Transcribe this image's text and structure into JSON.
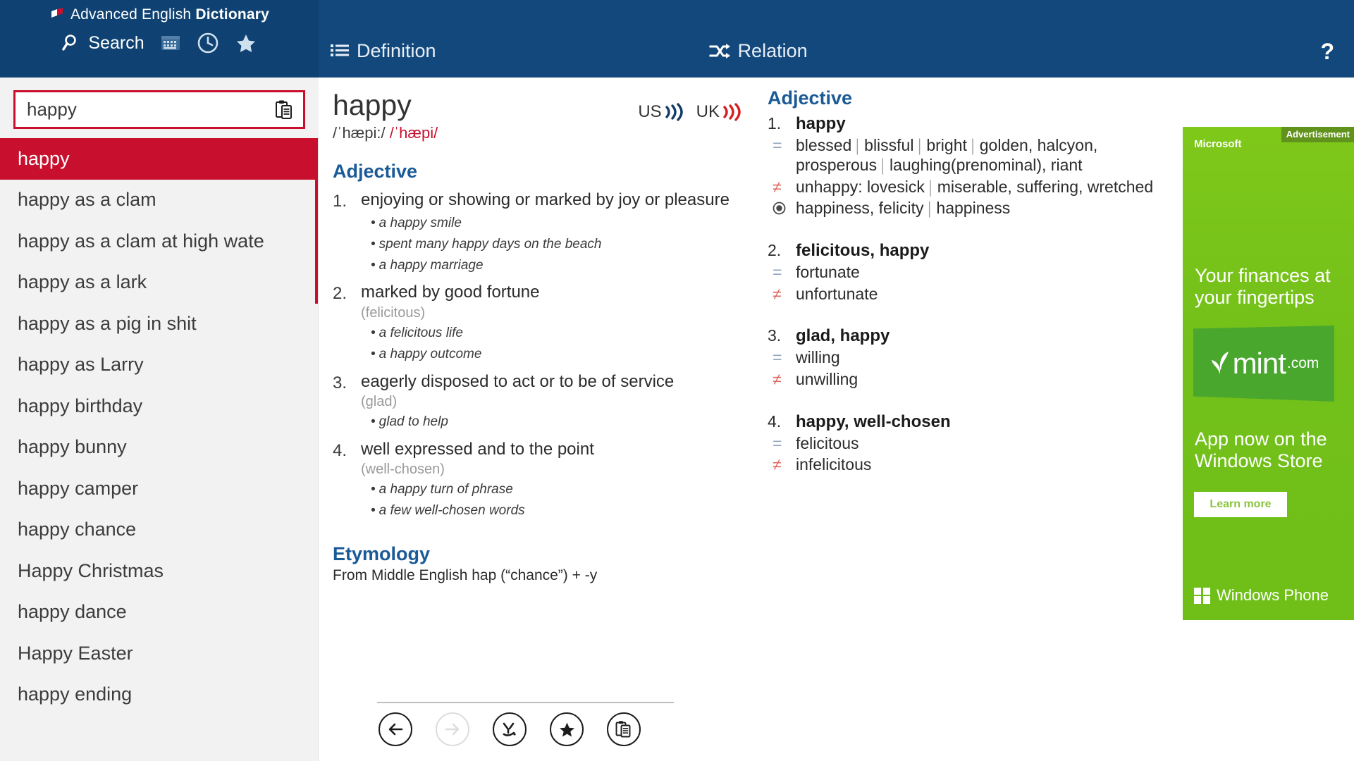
{
  "app": {
    "title_part1": "Advanced English ",
    "title_part2": "Dictionary",
    "logo_icon": "book-icon"
  },
  "sidebar": {
    "tools": [
      {
        "icon": "search-icon",
        "label": "Search",
        "name": "search"
      },
      {
        "icon": "keyboard-icon",
        "label": "",
        "name": "keyboard"
      },
      {
        "icon": "clock-icon",
        "label": "",
        "name": "history"
      },
      {
        "icon": "star-icon",
        "label": "",
        "name": "favorites"
      }
    ],
    "search": {
      "value": "happy",
      "placeholder": "",
      "paste_icon": "clipboard-icon"
    },
    "words": [
      {
        "label": "happy",
        "selected": true
      },
      {
        "label": "happy as a clam",
        "selected": false
      },
      {
        "label": "happy as a clam at high wate",
        "selected": false
      },
      {
        "label": "happy as a lark",
        "selected": false
      },
      {
        "label": "happy as a pig in shit",
        "selected": false
      },
      {
        "label": "happy as Larry",
        "selected": false
      },
      {
        "label": "happy birthday",
        "selected": false
      },
      {
        "label": "happy bunny",
        "selected": false
      },
      {
        "label": "happy camper",
        "selected": false
      },
      {
        "label": "happy chance",
        "selected": false
      },
      {
        "label": "Happy Christmas",
        "selected": false
      },
      {
        "label": "happy dance",
        "selected": false
      },
      {
        "label": "Happy Easter",
        "selected": false
      },
      {
        "label": "happy ending",
        "selected": false
      }
    ]
  },
  "topbar": {
    "tab_definition": "Definition",
    "tab_definition_icon": "list-icon",
    "tab_relation": "Relation",
    "tab_relation_icon": "shuffle-icon",
    "help_label": "?"
  },
  "definition": {
    "headword": "happy",
    "phonetic_us": "/ˈhæpi:/",
    "phonetic_uk": "/ˈhæpi/",
    "audio_us_label": "US",
    "audio_uk_label": "UK",
    "pos_title": "Adjective",
    "senses": [
      {
        "num": "1.",
        "gloss": "enjoying or showing or marked by joy or pleasure",
        "syn": "",
        "examples": [
          "a happy smile",
          "spent many happy days on the beach",
          "a happy marriage"
        ]
      },
      {
        "num": "2.",
        "gloss": "marked by good fortune",
        "syn": "(felicitous)",
        "examples": [
          "a felicitous life",
          "a happy outcome"
        ]
      },
      {
        "num": "3.",
        "gloss": "eagerly disposed to act or to be of service",
        "syn": "(glad)",
        "examples": [
          "glad to help"
        ]
      },
      {
        "num": "4.",
        "gloss": "well expressed and to the point",
        "syn": "(well-chosen)",
        "examples": [
          "a happy turn of phrase",
          "a few well-chosen words"
        ]
      }
    ],
    "etymology_title": "Etymology",
    "etymology_body": "From Middle English hap (“chance”) + -y"
  },
  "relation": {
    "pos_title": "Adjective",
    "groups": [
      {
        "num": "1.",
        "word": "happy",
        "lines": [
          {
            "sym": "=",
            "sym_type": "eq",
            "text": "blessed ⌷ blissful ⌷ bright ⌷ golden, halcyon, prosperous ⌷ laughing(prenominal), riant"
          },
          {
            "sym": "≠",
            "sym_type": "neq",
            "text": "unhappy: lovesick ⌷ miserable, suffering, wretched"
          },
          {
            "sym": "◉",
            "sym_type": "dot",
            "text": "happiness, felicity ⌷ happiness"
          }
        ]
      },
      {
        "num": "2.",
        "word": "felicitous, happy",
        "lines": [
          {
            "sym": "=",
            "sym_type": "eq",
            "text": "fortunate"
          },
          {
            "sym": "≠",
            "sym_type": "neq",
            "text": "unfortunate"
          }
        ]
      },
      {
        "num": "3.",
        "word": "glad, happy",
        "lines": [
          {
            "sym": "=",
            "sym_type": "eq",
            "text": "willing"
          },
          {
            "sym": "≠",
            "sym_type": "neq",
            "text": "unwilling"
          }
        ]
      },
      {
        "num": "4.",
        "word": "happy, well-chosen",
        "lines": [
          {
            "sym": "=",
            "sym_type": "eq",
            "text": "felicitous"
          },
          {
            "sym": "≠",
            "sym_type": "neq",
            "text": "infelicitous"
          }
        ]
      }
    ]
  },
  "ad": {
    "tag": "Advertisement",
    "brand": "Microsoft",
    "headline": "Your finances at your fingertips",
    "logo_text": "mint",
    "logo_suffix": ".com",
    "subline": "App now on the Windows Store",
    "cta": "Learn more",
    "footer": "Windows Phone",
    "bg_color": "#7ac70c"
  },
  "bottombar": {
    "buttons": [
      {
        "name": "back-button",
        "icon": "arrow-left-icon",
        "disabled": false
      },
      {
        "name": "forward-button",
        "icon": "arrow-right-icon",
        "disabled": true
      },
      {
        "name": "random-word-button",
        "icon": "random-icon",
        "disabled": false
      },
      {
        "name": "favorite-button",
        "icon": "star-icon",
        "disabled": false
      },
      {
        "name": "copy-button",
        "icon": "clipboard-icon",
        "disabled": false
      }
    ]
  },
  "colors": {
    "header_blue": "#0f4272",
    "topbar_blue": "#12487c",
    "accent_red": "#c8102e",
    "link_blue": "#1a5a96",
    "ad_green": "#7ac70c"
  }
}
